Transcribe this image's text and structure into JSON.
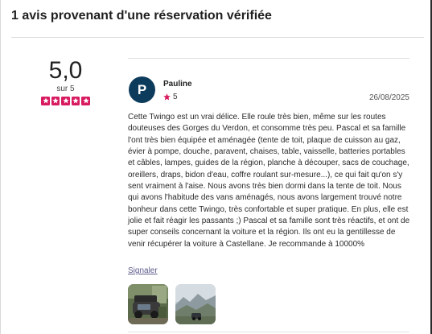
{
  "reviews_header": {
    "count": "1 avis",
    "text": " provenant d'une réservation vérifiée"
  },
  "summary": {
    "score": "5,0",
    "out_of": "sur 5",
    "stars": 5,
    "star_color": "#d81b60"
  },
  "review": {
    "avatar_letter": "P",
    "avatar_color": "#0d3b5c",
    "reviewer": "Pauline",
    "rating": "5",
    "date": "26/08/2025",
    "text": "Cette Twingo est un vrai délice. Elle roule très bien, même sur les routes douteuses des Gorges du Verdon, et consomme très peu. Pascal et sa famille l'ont très bien équipée et aménagée (tente de toit, plaque de cuisson au gaz, évier à pompe, douche, paravent, chaises, table, vaisselle, batteries portables et câbles, lampes, guides de la région, planche à découper, sacs de couchage, oreillers, draps, bidon d'eau, coffre roulant sur-mesure...), ce qui fait qu'on s'y sent vraiment à l'aise. Nous avons très bien dormi dans la tente de toit. Nous qui avons l'habitude des vans aménagés, nous avons largement trouvé notre bonheur dans cette Twingo, très confortable et super pratique. En plus, elle est jolie et fait réagir les passants ;) Pascal et sa famille sont très réactifs, et ont de super conseils concernant la voiture et la région. Ils ont eu la gentillesse de venir récupérer la voiture à Castellane. Je recommande à 10000%",
    "report_label": "Signaler",
    "photos": [
      "car-camping-photo",
      "mountain-landscape-photo"
    ]
  }
}
